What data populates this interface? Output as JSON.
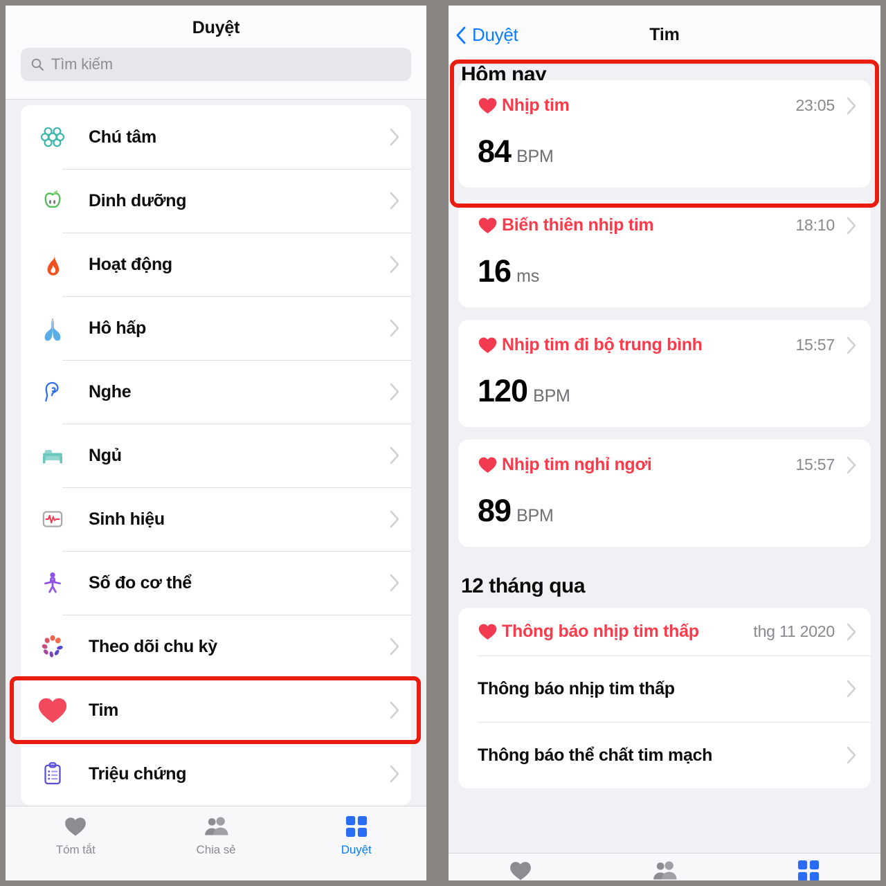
{
  "browse": {
    "title": "Duyệt",
    "search": {
      "placeholder": "Tìm kiếm",
      "icon": "search-icon"
    },
    "items": [
      {
        "label": "Chú tâm",
        "icon": "brain-icon"
      },
      {
        "label": "Dinh dưỡng",
        "icon": "apple-icon"
      },
      {
        "label": "Hoạt động",
        "icon": "flame-icon"
      },
      {
        "label": "Hô hấp",
        "icon": "lungs-icon"
      },
      {
        "label": "Nghe",
        "icon": "ear-icon"
      },
      {
        "label": "Ngủ",
        "icon": "bed-icon"
      },
      {
        "label": "Sinh hiệu",
        "icon": "vitals-icon"
      },
      {
        "label": "Số đo cơ thể",
        "icon": "body-icon"
      },
      {
        "label": "Theo dõi chu kỳ",
        "icon": "cycle-icon"
      },
      {
        "label": "Tim",
        "icon": "heart-icon"
      },
      {
        "label": "Triệu chứng",
        "icon": "clipboard-icon"
      }
    ],
    "tabs": [
      {
        "label": "Tóm tắt",
        "icon": "heart-icon",
        "active": false
      },
      {
        "label": "Chia sẻ",
        "icon": "people-icon",
        "active": false
      },
      {
        "label": "Duyệt",
        "icon": "grid-icon",
        "active": true
      }
    ]
  },
  "heart": {
    "back_label": "Duyệt",
    "title": "Tim",
    "section_today": "Hôm nay",
    "section_year": "12 tháng qua",
    "metrics": [
      {
        "name": "Nhịp tim",
        "time": "23:05",
        "value": "84",
        "unit": "BPM",
        "icon": "heart-icon"
      },
      {
        "name": "Biến thiên nhịp tim",
        "time": "18:10",
        "value": "16",
        "unit": "ms",
        "icon": "heart-icon"
      },
      {
        "name": "Nhịp tim đi bộ trung bình",
        "time": "15:57",
        "value": "120",
        "unit": "BPM",
        "icon": "heart-icon"
      },
      {
        "name": "Nhịp tim nghỉ ngơi",
        "time": "15:57",
        "value": "89",
        "unit": "BPM",
        "icon": "heart-icon"
      }
    ],
    "notifications": {
      "head_name": "Thông báo nhịp tim thấp",
      "head_time": "thg 11 2020",
      "icon": "heart-icon",
      "rows": [
        {
          "label": "Thông báo nhịp tim thấp"
        },
        {
          "label": "Thông báo thể chất tim mạch"
        }
      ]
    }
  },
  "colors": {
    "accent_blue": "#0a7cff",
    "heart_red": "#fa3b4c",
    "highlight_red": "#e81c10",
    "frame_gray": "#878481"
  }
}
